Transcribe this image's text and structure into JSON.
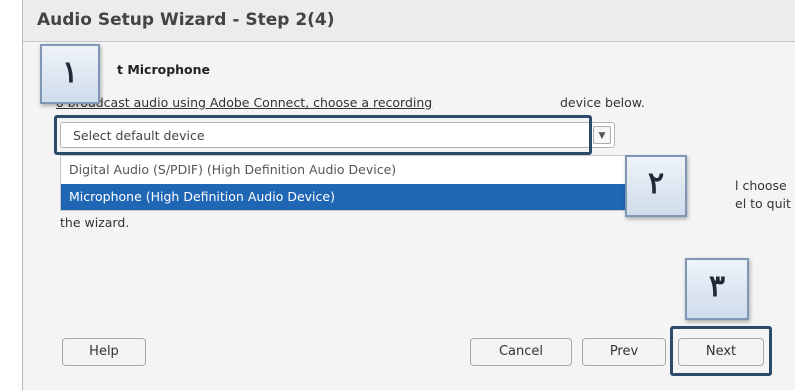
{
  "window": {
    "title": "Audio Setup Wizard - Step 2(4)"
  },
  "section": {
    "heading": "t Microphone"
  },
  "instructions": {
    "text": "o broadcast audio using Adobe Connect, choose a recording",
    "tail": "device below."
  },
  "device_select": {
    "value": "Select default device",
    "options": [
      "Digital Audio (S/PDIF) (High Definition Audio Device)",
      "Microphone (High Definition Audio Device)"
    ],
    "highlighted_index": 1
  },
  "side_text": {
    "line1": "l choose",
    "line2": "el to quit",
    "tail": "the wizard."
  },
  "buttons": {
    "help": "Help",
    "cancel": "Cancel",
    "prev": "Prev",
    "next": "Next"
  },
  "callouts": {
    "step1": "١",
    "step2": "٢",
    "step3": "٣"
  },
  "colors": {
    "selection": "#1f66b4",
    "callout_border": "#2e4a6a"
  }
}
